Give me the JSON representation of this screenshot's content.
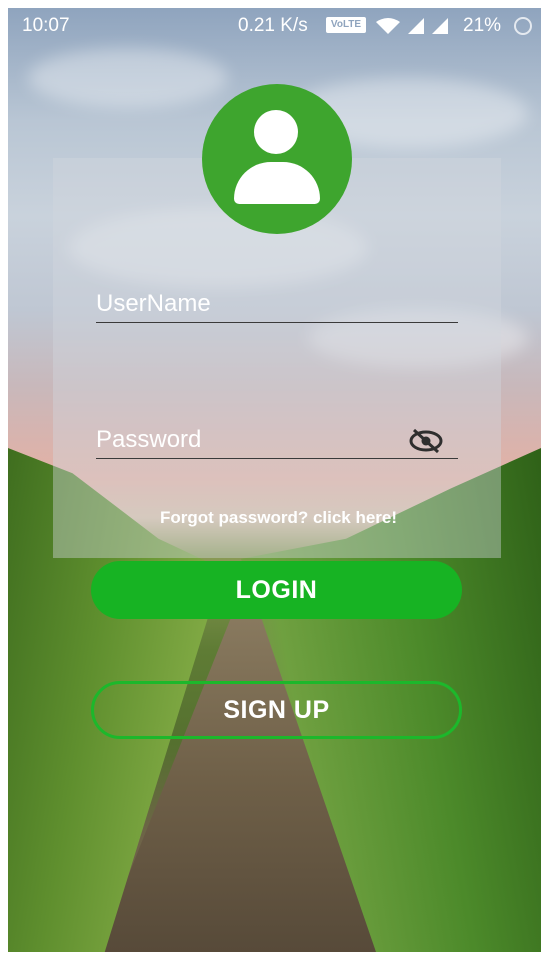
{
  "status_bar": {
    "time": "10:07",
    "network_speed": "0.21 K/s",
    "volte": "VoLTE",
    "battery": "21%"
  },
  "login_form": {
    "username_placeholder": "UserName",
    "password_placeholder": "Password",
    "forgot_link": "Forgot password? click here!",
    "login_label": "LOGIN",
    "signup_label": "SIGN UP"
  },
  "colors": {
    "accent_green": "#17b323",
    "avatar_green": "#3ea52e"
  },
  "icons": {
    "avatar": "user-icon",
    "password_toggle": "eye-off-icon"
  }
}
